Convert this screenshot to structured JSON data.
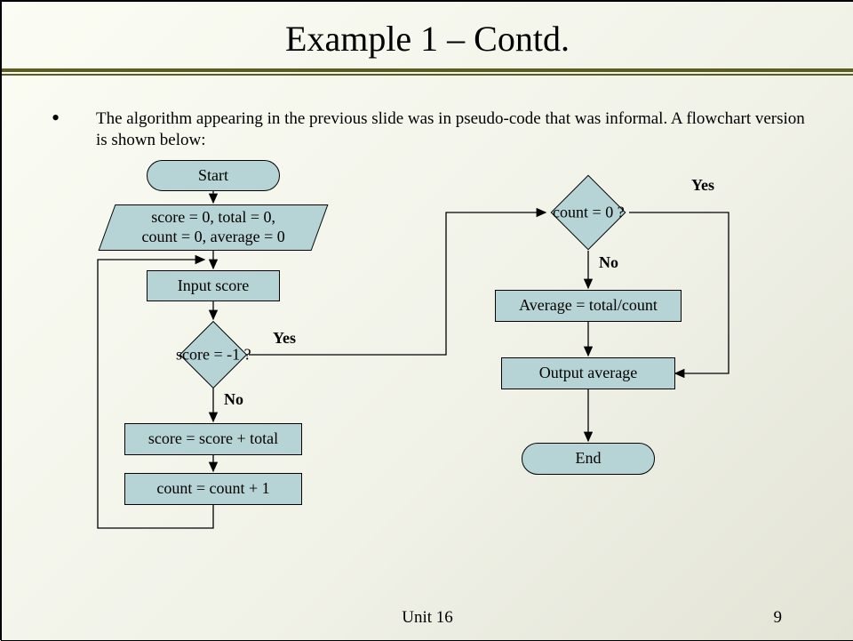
{
  "title": "Example 1 – Contd.",
  "body": "The algorithm appearing in the previous slide was in pseudo-code that was informal. A flowchart version is shown below:",
  "footer_unit": "Unit 16",
  "page_number": "9",
  "labels": {
    "yes1": "Yes",
    "no1": "No",
    "yes2": "Yes",
    "no2": "No"
  },
  "nodes": {
    "start": "Start",
    "init_l1": "score = 0, total = 0,",
    "init_l2": "count = 0, average = 0",
    "input": "Input score",
    "dec1": "score = -1 ?",
    "proc1": "score = score + total",
    "proc2": "count = count + 1",
    "dec2": "count = 0 ?",
    "avg": "Average = total/count",
    "out": "Output average",
    "end": "End"
  }
}
